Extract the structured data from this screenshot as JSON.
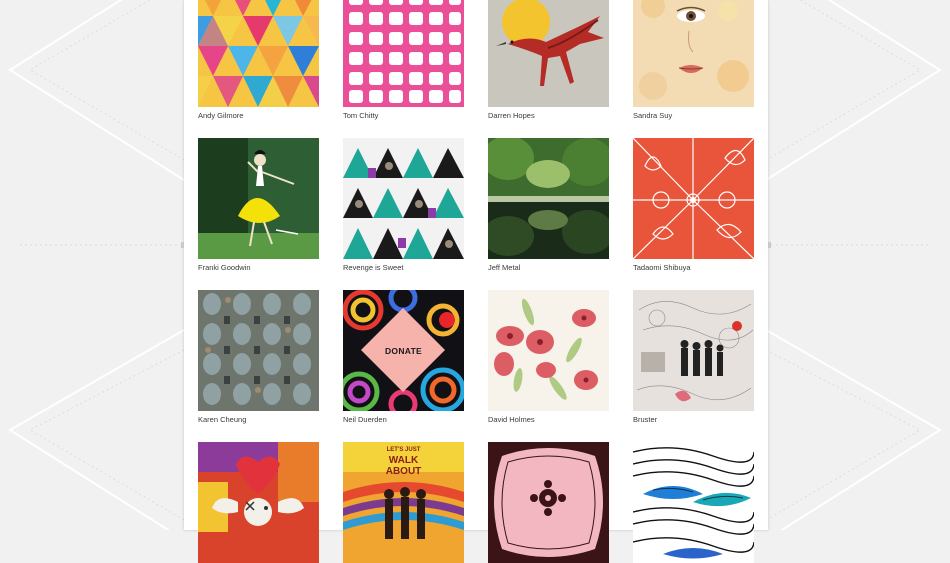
{
  "gallery": {
    "items": [
      {
        "artist": "Andy Gilmore",
        "art": "geometric-triangles"
      },
      {
        "artist": "Tom Chitty",
        "art": "pink-pattern"
      },
      {
        "artist": "Darren Hopes",
        "art": "red-crane-sun"
      },
      {
        "artist": "Sandra Suy",
        "art": "watercolor-face"
      },
      {
        "artist": "Franki Goodwin",
        "art": "dancer-yellow-skirt"
      },
      {
        "artist": "Revenge is Sweet",
        "art": "triangle-pattern"
      },
      {
        "artist": "Jeff Metal",
        "art": "forest-river-reflection"
      },
      {
        "artist": "Tadaomi Shibuya",
        "art": "butterfly-floral-orange"
      },
      {
        "artist": "Karen Cheung",
        "art": "grey-blue-pattern"
      },
      {
        "artist": "Neil Duerden",
        "art": "psychedelic-donate",
        "button_label": "DONATE"
      },
      {
        "artist": "David Holmes",
        "art": "red-poppies-watercolor"
      },
      {
        "artist": "Bruster",
        "art": "collage-figures"
      },
      {
        "artist": "",
        "art": "colorful-collage"
      },
      {
        "artist": "",
        "art": "walk-about-poster",
        "title_line1": "LET'S JUST",
        "title_line2": "WALK",
        "title_line3": "ABOUT"
      },
      {
        "artist": "",
        "art": "pink-ornate-frame"
      },
      {
        "artist": "",
        "art": "blue-feather-lines"
      }
    ]
  }
}
